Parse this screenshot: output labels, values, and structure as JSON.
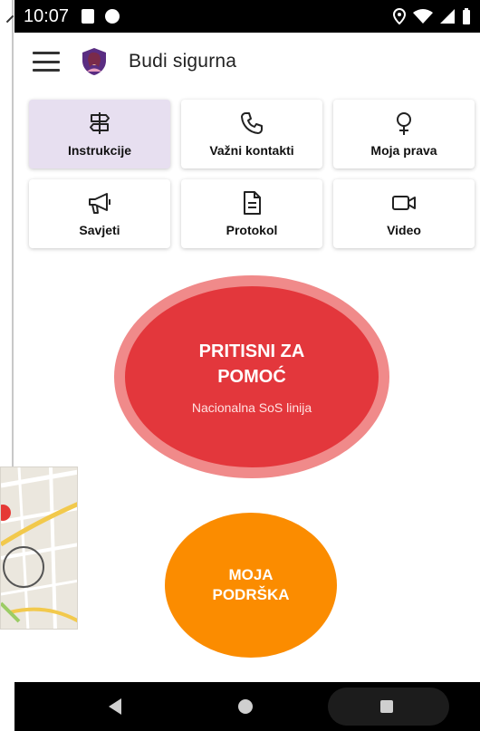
{
  "status_bar": {
    "time": "10:07"
  },
  "app_bar": {
    "title": "Budi sigurna"
  },
  "tiles": [
    {
      "label": "Instrukcije",
      "icon": "signpost-icon",
      "active": true
    },
    {
      "label": "Važni kontakti",
      "icon": "phone-icon",
      "active": false
    },
    {
      "label": "Moja prava",
      "icon": "female-symbol-icon",
      "active": false
    },
    {
      "label": "Savjeti",
      "icon": "megaphone-icon",
      "active": false
    },
    {
      "label": "Protokol",
      "icon": "document-icon",
      "active": false
    },
    {
      "label": "Video",
      "icon": "video-camera-icon",
      "active": false
    }
  ],
  "sos": {
    "title": "PRITISNI ZA POMOĆ",
    "subtitle": "Nacionalna SoS linija"
  },
  "support": {
    "label": "MOJA PODRŠKA"
  },
  "colors": {
    "primary": "#5a2d82",
    "tile_active_bg": "#e7dff0",
    "sos_red": "#e3373c",
    "sos_ring": "#f08a8a",
    "support_orange": "#fb8c00"
  }
}
